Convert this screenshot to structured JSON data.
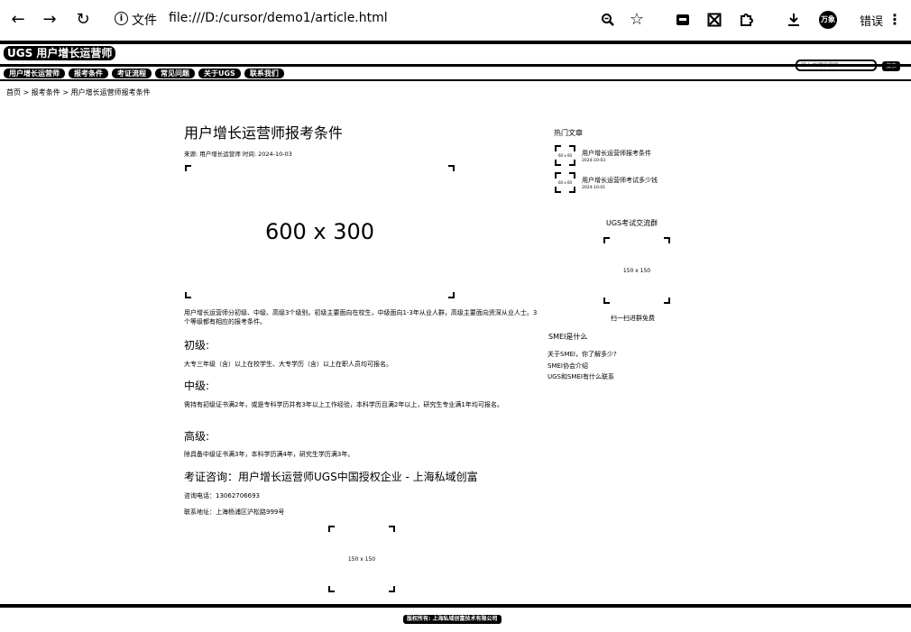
{
  "browser": {
    "url_label": "文件",
    "url": "file:///D:/cursor/demo1/article.html",
    "profile_label": "万象",
    "error_label": "错误"
  },
  "site": {
    "logo": "UGS 用户增长运营师",
    "nav": [
      "用户增长运营师",
      "报考条件",
      "考证流程",
      "常见问题",
      "关于UGS",
      "联系我们"
    ],
    "search_placeholder": "输入关键字搜索",
    "search_button": "搜索"
  },
  "breadcrumb": [
    "首页",
    ">",
    "报考条件",
    ">",
    "用户增长运营师报考条件"
  ],
  "article": {
    "title": "用户增长运营师报考条件",
    "meta": "来源: 用户增长运营师 时间: 2024-10-03",
    "image_main": "600 x 300",
    "intro": "用户增长运营师分初级、中级、高级3个级别。初级主要面向在校生，中级面向1-3年从业人群，高级主要面向资深从业人士。3个等级都有相应的报考条件。",
    "sections": [
      {
        "heading": "初级:",
        "text": "大专三年级（含）以上在校学生、大专学历（含）以上在职人员均可报名。"
      },
      {
        "heading": "中级:",
        "text": "需持有初级证书满2年，或是专科学历并有3年以上工作经验，本科学历且满2年以上，研究生专业满1年均可报名。"
      },
      {
        "heading": "高级:",
        "text": "除具备中级证书满3年，本科学历满4年，研究生学历满3年。"
      }
    ],
    "consult": "考证咨询：用户增长运营师UGS中国授权企业 - 上海私域创富",
    "phone": "咨询电话：13062706693",
    "address": "联系地址：上海杨浦区沪松路999号",
    "image_bottom": "150 x 150"
  },
  "sidebar": {
    "hot_title": "热门文章",
    "hot": [
      {
        "title": "用户增长运营师报考条件",
        "date": "2024-10-03",
        "thumb": "60 x 60"
      },
      {
        "title": "用户增长运营师考试多少钱",
        "date": "2024-10-01",
        "thumb": "60 x 60"
      }
    ],
    "group_title": "UGS考试交流群",
    "qr_image": "150 x 150",
    "qr_caption": "扫一扫进群免费",
    "smei_title": "SMEI是什么",
    "smei_links": [
      "关于SMEI，你了解多少?",
      "SMEI协会介绍",
      "UGS和SMEI有什么联系"
    ]
  },
  "footer": {
    "copyright": "版权所有: 上海私域创富技术有限公司"
  }
}
